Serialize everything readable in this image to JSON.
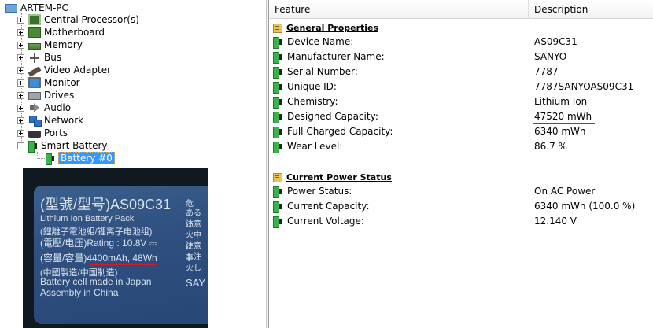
{
  "tree": {
    "root": {
      "label": "ARTEM-PC",
      "icon": "computer-icon"
    },
    "nodes": [
      {
        "label": "Central Processor(s)",
        "icon": "cpu-icon",
        "expander": "+"
      },
      {
        "label": "Motherboard",
        "icon": "motherboard-icon",
        "expander": "+"
      },
      {
        "label": "Memory",
        "icon": "memory-icon",
        "expander": "+"
      },
      {
        "label": "Bus",
        "icon": "bus-icon",
        "expander": "+"
      },
      {
        "label": "Video Adapter",
        "icon": "video-adapter-icon",
        "expander": "+"
      },
      {
        "label": "Monitor",
        "icon": "monitor-icon",
        "expander": "+"
      },
      {
        "label": "Drives",
        "icon": "drive-icon",
        "expander": "+"
      },
      {
        "label": "Audio",
        "icon": "speaker-icon",
        "expander": "+"
      },
      {
        "label": "Network",
        "icon": "network-icon",
        "expander": "+"
      },
      {
        "label": "Ports",
        "icon": "port-icon",
        "expander": "+"
      },
      {
        "label": "Smart Battery",
        "icon": "battery-icon",
        "expander": "-"
      }
    ],
    "selected_child": {
      "label": "Battery #0",
      "icon": "battery-icon"
    }
  },
  "photo": {
    "model_line": "(型號/型号)AS09C31",
    "pack_line": "Lithium Ion Battery Pack",
    "chinese_line": "(鋰離子電池組/锂离子电池组)",
    "rating_line": "(電壓/电压)Rating : 10.8V ⎓",
    "capacity_line": "(容量/容量)4400mAh, 48Wh",
    "origin_chinese_line": "(中國製造/中国制造)",
    "origin_line_1": "Battery cell made in Japan",
    "origin_line_2": "Assembly in China",
    "side_lines": [
      "危",
      "あるい",
      "注意",
      "火中に",
      "注意事",
      "ト注",
      "火し",
      "SAY"
    ],
    "underline_color": "#e0181e"
  },
  "details": {
    "columns": {
      "feature": "Feature",
      "description": "Description"
    },
    "groups": [
      {
        "title": "General Properties",
        "rows": [
          {
            "feature": "Device Name:",
            "value": "AS09C31"
          },
          {
            "feature": "Manufacturer Name:",
            "value": "SANYO"
          },
          {
            "feature": "Serial Number:",
            "value": "7787"
          },
          {
            "feature": "Unique ID:",
            "value": "7787SANYOAS09C31"
          },
          {
            "feature": "Chemistry:",
            "value": "Lithium Ion"
          },
          {
            "feature": "Designed Capacity:",
            "value": "47520 mWh"
          },
          {
            "feature": "Full Charged Capacity:",
            "value": "6340 mWh"
          },
          {
            "feature": "Wear Level:",
            "value": "86.7 %"
          }
        ]
      },
      {
        "title": "Current Power Status",
        "rows": [
          {
            "feature": "Power Status:",
            "value": "On AC Power"
          },
          {
            "feature": "Current Capacity:",
            "value": "6340 mWh (100.0 %)"
          },
          {
            "feature": "Current Voltage:",
            "value": "12.140 V"
          }
        ]
      }
    ]
  },
  "colors": {
    "selection": "#3399ff",
    "battery_green": "#39b34a",
    "highlight_red": "#e0181e"
  }
}
